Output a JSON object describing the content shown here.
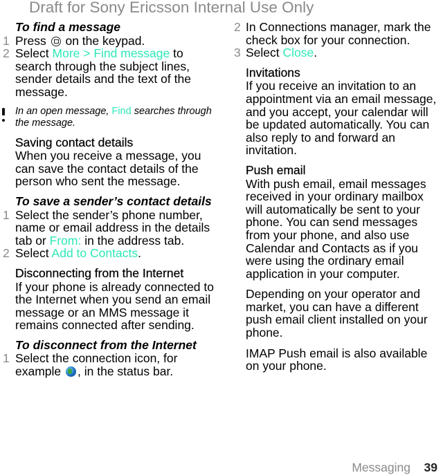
{
  "watermark": "Draft for Sony Ericsson Internal Use Only",
  "left": {
    "find_task": "To find a message",
    "find_steps": [
      {
        "num": "1",
        "pre": "Press",
        "post": "on the keypad.",
        "icon": "message-key-icon"
      },
      {
        "num": "2",
        "pre": "Select",
        "link": "More > Find message",
        "post": "to search through the subject lines, sender details and the text of the message."
      }
    ],
    "note": {
      "pre": "In an open message,",
      "link": "Find",
      "post": "searches through the message."
    },
    "saving_heading": "Saving contact details",
    "saving_para": "When you receive a message, you can save the contact details of the person who sent the message.",
    "save_task": "To save a sender’s contact details",
    "save_steps": [
      {
        "num": "1",
        "pre": "Select the sender’s phone number, name or email address in the details tab or",
        "link": "From:",
        "post": "in the address tab."
      },
      {
        "num": "2",
        "pre": "Select",
        "link": "Add to Contacts",
        "post": "."
      }
    ],
    "disconnect_heading": "Disconnecting from the Internet",
    "disconnect_para": "If your phone is already connected to the Internet when you send an email message or an MMS message it remains connected after sending.",
    "disconnect_task": "To disconnect from the Internet",
    "disconnect_step1": {
      "num": "1",
      "pre": "Select the connection icon, for example",
      "post": ", in the status bar.",
      "icon": "globe-icon"
    }
  },
  "right": {
    "disconnect_steps": [
      {
        "num": "2",
        "text": "In Connections manager, mark the check box for your connection."
      },
      {
        "num": "3",
        "pre": "Select",
        "link": "Close",
        "post": "."
      }
    ],
    "invitations_heading": "Invitations",
    "invitations_para": "If you receive an invitation to an appointment via an email message, and you accept, your calendar will be updated automatically. You can also reply to and forward an invitation.",
    "push_heading": "Push email",
    "push_para1": "With push email, email messages received in your ordinary mailbox will automatically be sent to your phone. You can send messages from your phone, and also use Calendar and Contacts as if you were using the ordinary email application in your computer.",
    "push_para2": "Depending on your operator and market, you can have a different push email client installed on your phone.",
    "push_para3": "IMAP Push email is also available on your phone."
  },
  "footer": {
    "section": "Messaging",
    "page": "39"
  },
  "colors": {
    "link": "#2ee8b8",
    "step_number": "#8a8a8a",
    "watermark": "#8a8a8a"
  }
}
